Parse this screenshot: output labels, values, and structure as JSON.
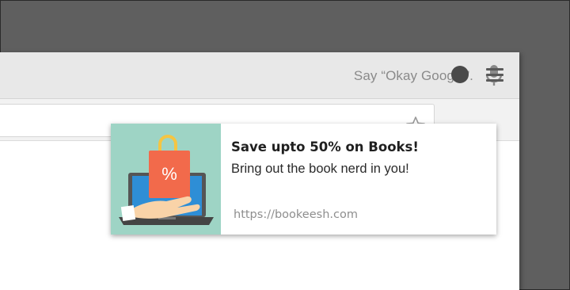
{
  "browser": {
    "voice_hint": "Say “Okay Google”.",
    "icons": {
      "mic": "microphone-icon",
      "star": "star-icon",
      "extension": "extension-icon",
      "menu": "hamburger-menu-icon"
    }
  },
  "notification": {
    "title": "Save upto 50% on Books!",
    "body": "Bring out the book nerd in you!",
    "url": "https://bookeesh.com",
    "image_icon": "shopping-bag-laptop-illustration",
    "bag_symbol": "%",
    "colors": {
      "image_bg": "#9ed4c5",
      "bag": "#f26a4b",
      "laptop_screen": "#2e8ed6",
      "laptop_body": "#555555",
      "hand": "#f9d3a8",
      "handle": "#f5c542"
    }
  }
}
